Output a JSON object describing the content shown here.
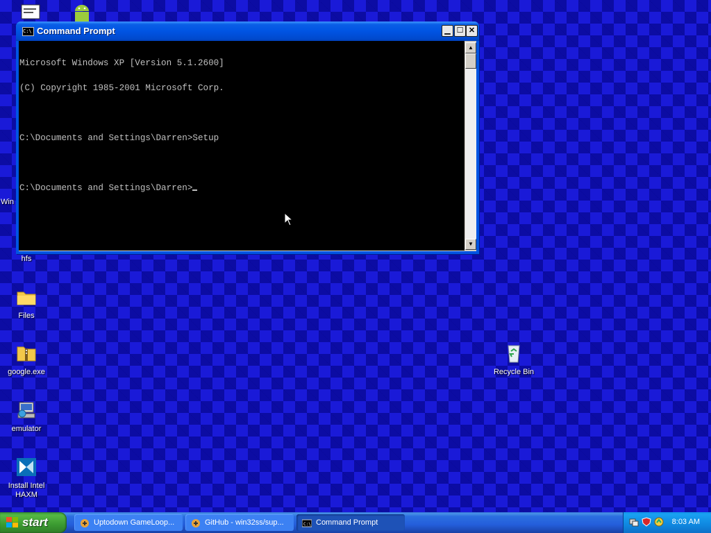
{
  "desktop": {
    "icons": [
      {
        "id": "files",
        "label": "Files"
      },
      {
        "id": "google",
        "label": "google.exe"
      },
      {
        "id": "emulator",
        "label": "emulator"
      },
      {
        "id": "haxm",
        "label": "Install Intel HAXM"
      },
      {
        "id": "hfs",
        "label": "hfs"
      },
      {
        "id": "recycle",
        "label": "Recycle Bin"
      },
      {
        "id": "wine",
        "label": "Win"
      }
    ]
  },
  "window": {
    "title": "Command Prompt",
    "icon": "cmd-icon",
    "icon_text": "C:\\",
    "console_lines": [
      "Microsoft Windows XP [Version 5.1.2600]",
      "(C) Copyright 1985-2001 Microsoft Corp.",
      "",
      "C:\\Documents and Settings\\Darren>Setup",
      "",
      "C:\\Documents and Settings\\Darren>"
    ]
  },
  "taskbar": {
    "start_label": "start",
    "tasks": [
      {
        "label": "Uptodown GameLoop...",
        "icon": "uptodown-icon"
      },
      {
        "label": "GitHub - win32ss/sup...",
        "icon": "github-icon"
      },
      {
        "label": "Command Prompt",
        "icon": "cmd-icon",
        "active": true
      }
    ],
    "clock": "8:03 AM"
  },
  "colors": {
    "desktop": "#1a1ad8",
    "titlebar": "#0054e3",
    "console_bg": "#000000",
    "console_fg": "#c0c0c0",
    "start": "#3b9a31"
  }
}
